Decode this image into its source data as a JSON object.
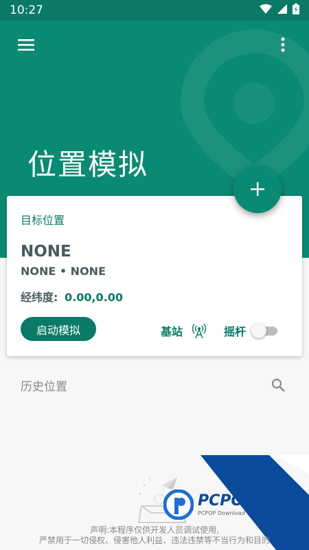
{
  "status_bar": {
    "time": "10:27"
  },
  "header": {
    "title": "位置模拟"
  },
  "card": {
    "label": "目标位置",
    "location_name": "NONE",
    "location_sub": "NONE • NONE",
    "coord_label": "经纬度:",
    "coord_value": "0.00,0.00",
    "start_button": "启动模拟",
    "base_station": "基站",
    "joystick": "摇杆",
    "joystick_enabled": false
  },
  "history": {
    "label": "历史位置"
  },
  "footer": {
    "disclaimer_line1": "声明:本程序仅供开发人员调试使用,",
    "disclaimer_line2": "严禁用于一切侵权、侵害他人利益、违法违禁等不当行为和目的"
  },
  "watermark": {
    "brand": "PCPOP下载",
    "sub": "PCPOP Download"
  },
  "colors": {
    "primary": "#0b8a73",
    "primary_dark": "#0a7a67",
    "text_secondary": "#4a5a5e"
  },
  "icons": [
    "wifi-icon",
    "signal-icon",
    "battery-icon",
    "menu-icon",
    "more-vert-icon",
    "add-icon",
    "antenna-icon",
    "search-icon"
  ]
}
